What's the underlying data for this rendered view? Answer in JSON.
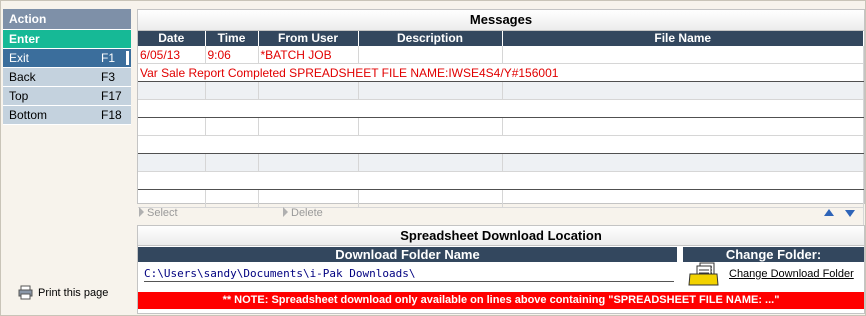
{
  "action_panel": {
    "title": "Action",
    "enter_label": "Enter",
    "items": [
      {
        "label": "Exit",
        "key": "F1"
      },
      {
        "label": "Back",
        "key": "F3"
      },
      {
        "label": "Top",
        "key": "F17"
      },
      {
        "label": "Bottom",
        "key": "F18"
      }
    ],
    "print_label": "Print this page"
  },
  "messages": {
    "title": "Messages",
    "columns": [
      "Date",
      "Time",
      "From User",
      "Description",
      "File Name"
    ],
    "row": {
      "date": "6/05/13",
      "time": "9:06",
      "from_user": "*BATCH JOB",
      "description": "",
      "file_name": ""
    },
    "detail_line": "Var Sale Report Completed SPREADSHEET FILE NAME:IWSE4S4/Y#156001",
    "select_label": "Select",
    "delete_label": "Delete"
  },
  "spreadsheet": {
    "title": "Spreadsheet Download Location",
    "folder_header": "Download Folder Name",
    "change_header": "Change Folder:",
    "folder_path": "C:\\Users\\sandy\\Documents\\i-Pak Downloads\\",
    "change_label": "Change Download Folder",
    "note": "** NOTE:  Spreadsheet download only available on lines above containing \"SPREADSHEET FILE NAME: ...\""
  },
  "colors": {
    "header_navy": "#33475e",
    "accent_green": "#16b996",
    "message_red": "#e10000",
    "note_red": "#ff0000",
    "arrow_blue": "#2e64b8"
  }
}
